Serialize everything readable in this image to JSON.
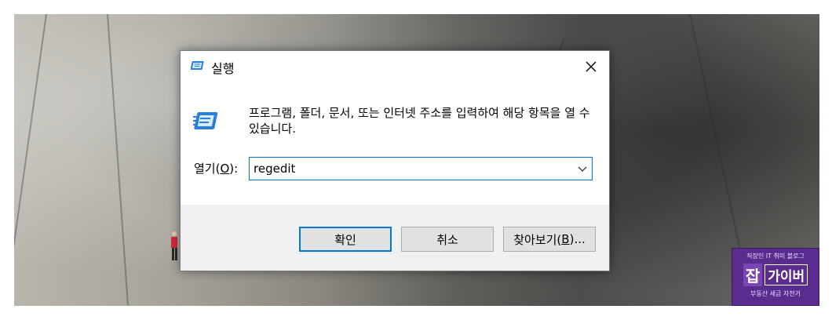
{
  "dialog": {
    "title": "실행",
    "description": "프로그램, 폴더, 문서, 또는 인터넷 주소를 입력하여 해당 항목을 열 수 있습니다.",
    "open_label_prefix": "열기(",
    "open_label_accel": "O",
    "open_label_suffix": "):",
    "open_value": "regedit",
    "ok_label": "확인",
    "cancel_label": "취소",
    "browse_label_prefix": "찾아보기(",
    "browse_label_accel": "B",
    "browse_label_suffix": ")..."
  },
  "watermark": {
    "top_text": "직장인 IT 취미 블로그",
    "big_char": "잡",
    "name": "가이버",
    "bottom_text": "부동산 세금 자전거"
  },
  "icons": {
    "title": "run-icon",
    "dialog": "run-icon",
    "close": "close-icon",
    "dropdown": "chevron-down-icon"
  },
  "colors": {
    "accent": "#0078d7",
    "footer_bg": "#f0f0f0",
    "button_bg": "#e1e1e1",
    "watermark_bg": "#5b2c8f"
  }
}
